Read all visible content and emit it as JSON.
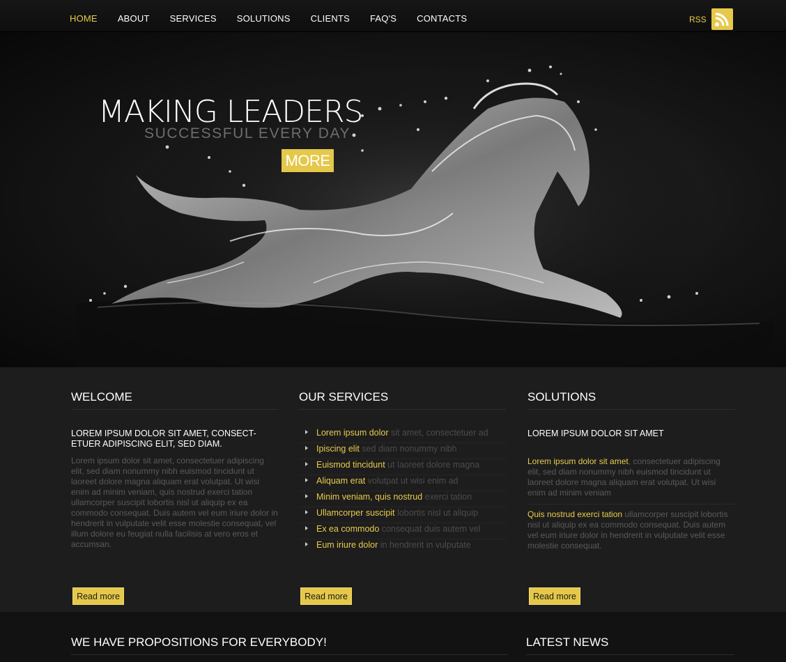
{
  "nav": {
    "items": [
      "HOME",
      "ABOUT",
      "SERVICES",
      "SOLUTIONS",
      "CLIENTS",
      "FAQ'S",
      "CONTACTS"
    ],
    "active": "HOME",
    "rss_label": "RSS"
  },
  "hero": {
    "title": "MAKING LEADERS",
    "subtitle": "SUCCESSFUL EVERY DAY",
    "more_label": "MORE"
  },
  "welcome": {
    "heading": "WELCOME",
    "intro": "LOREM IPSUM DOLOR SIT AMET, CONSECT-ETUER ADIPISCING ELIT, SED DIAM.",
    "body": "Lorem ipsum dolor sit amet, consectetuer adipiscing elit, sed diam nonummy nibh euismod tincidunt ut laoreet dolore magna aliquam erat volutpat. Ut wisi enim ad minim veniam, quis nostrud exerci tation ullamcorper suscipit lobortis nisl ut aliquip ex ea commodo consequat. Duis autem vel eum iriure dolor in hendrerit in vulputate velit esse molestie consequat, vel illum dolore eu feugiat nulla facilisis at vero eros et accumsan.",
    "read_more": "Read more"
  },
  "services": {
    "heading": "OUR SERVICES",
    "items": [
      {
        "link": "Lorem ipsum dolor",
        "rest": "sit amet, consectetuer ad"
      },
      {
        "link": "Ipiscing elit",
        "rest": "sed diam nonummy nibh"
      },
      {
        "link": "Euismod tincidunt",
        "rest": "ut laoreet dolore magna"
      },
      {
        "link": "Aliquam erat",
        "rest": "volutpat ut wisi enim ad"
      },
      {
        "link": "Minim veniam, quis nostrud",
        "rest": "exerci tation"
      },
      {
        "link": "Ullamcorper suscipit",
        "rest": "lobortis nisl ut aliquip"
      },
      {
        "link": "Ex ea commodo",
        "rest": "consequat duis autem vel"
      },
      {
        "link": "Eum iriure dolor",
        "rest": "in hendrerit in vulputate"
      }
    ],
    "read_more": "Read more"
  },
  "solutions": {
    "heading": "SOLUTIONS",
    "intro": "LOREM IPSUM DOLOR SIT AMET",
    "para1_link": "Lorem ipsum dolor sit amet",
    "para1_rest": ", consectetuer adipiscing elit, sed diam nonummy nibh euismod tincidunt ut laoreet dolore magna aliquam erat volutpat. Ut wisi enim ad minim veniam",
    "para2_link": "Quis nostrud exerci tation",
    "para2_rest": " ullamcorper suscipit lobortis nisl ut aliquip ex ea commodo consequat. Duis autem vel eum iriure dolor in hendrerit in vulputate velit esse molestie consequat.",
    "read_more": "Read more"
  },
  "bottom": {
    "propositions_heading": "WE HAVE PROPOSITIONS FOR EVERYBODY!",
    "news_heading": "LATEST NEWS"
  },
  "colors": {
    "accent": "#e8cc4d",
    "background": "#1a1a1a"
  }
}
